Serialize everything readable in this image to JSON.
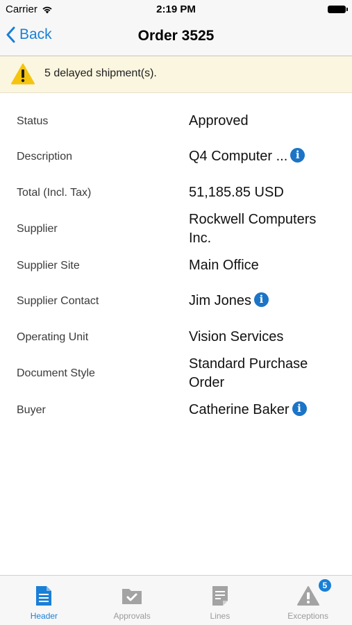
{
  "status_bar": {
    "carrier": "Carrier",
    "time": "2:19 PM"
  },
  "nav": {
    "back_label": "Back",
    "title": "Order 3525"
  },
  "banner": {
    "icon": "warning-icon",
    "text": "5 delayed shipment(s)."
  },
  "details": [
    {
      "label": "Status",
      "value": "Approved",
      "info": false
    },
    {
      "label": "Description",
      "value": "Q4 Computer ...",
      "info": true
    },
    {
      "label": "Total (Incl. Tax)",
      "value": "51,185.85 USD",
      "info": false
    },
    {
      "label": "Supplier",
      "value": "Rockwell Computers Inc.",
      "info": false
    },
    {
      "label": "Supplier Site",
      "value": "Main Office",
      "info": false
    },
    {
      "label": "Supplier Contact",
      "value": "Jim Jones",
      "info": true
    },
    {
      "label": "Operating Unit",
      "value": "Vision Services",
      "info": false
    },
    {
      "label": "Document Style",
      "value": "Standard Purchase Order",
      "info": false
    },
    {
      "label": "Buyer",
      "value": "Catherine Baker",
      "info": true
    }
  ],
  "tabs": [
    {
      "label": "Header",
      "icon": "document-icon",
      "active": true
    },
    {
      "label": "Approvals",
      "icon": "approval-folder-icon",
      "active": false
    },
    {
      "label": "Lines",
      "icon": "lines-document-icon",
      "active": false
    },
    {
      "label": "Exceptions",
      "icon": "warning-icon",
      "active": false,
      "badge": "5"
    }
  ],
  "colors": {
    "accent": "#1a7fd6",
    "banner_bg": "#fbf6df",
    "warning": "#f5c40f",
    "info": "#1c74c6",
    "inactive_tab": "#9a9a9a"
  }
}
